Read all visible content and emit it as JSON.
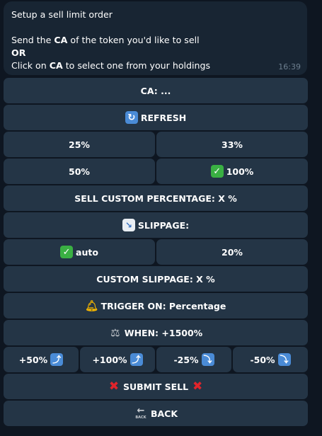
{
  "message": {
    "title": "Setup a sell limit order",
    "line2_pre": "Send the ",
    "line2_bold": "CA",
    "line2_post": " of the token you'd like to sell",
    "or": "OR",
    "line4_pre": "Click on ",
    "line4_bold": "CA",
    "line4_post": " to select one from your holdings",
    "time": "16:39"
  },
  "buttons": {
    "ca": "CA: ...",
    "refresh": "REFRESH",
    "p25": "25%",
    "p33": "33%",
    "p50": "50%",
    "p100": "100%",
    "sell_custom": "SELL CUSTOM PERCENTAGE: X %",
    "slippage": "SLIPPAGE:",
    "auto": "auto",
    "s20": "20%",
    "custom_slippage": "CUSTOM SLIPPAGE: X %",
    "trigger": "TRIGGER ON: Percentage",
    "when": "WHEN: +1500%",
    "plus50": "+50%",
    "plus100": "+100%",
    "minus25": "-25%",
    "minus50": "-50%",
    "submit": "SUBMIT SELL",
    "back": "BACK",
    "back_icon_text": "BACK"
  },
  "icons": {
    "refresh": "refresh-icon",
    "check": "check-mark-icon",
    "chart": "chart-down-icon",
    "bell": "bell-icon",
    "scale": "balance-scale-icon",
    "up": "arrow-up-right-icon",
    "down": "arrow-down-right-icon",
    "cross": "cross-mark-icon",
    "back": "back-arrow-icon"
  },
  "colors": {
    "background": "#0e1621",
    "bubble": "#182533",
    "button": "#243546",
    "time": "#6d7f8f"
  }
}
